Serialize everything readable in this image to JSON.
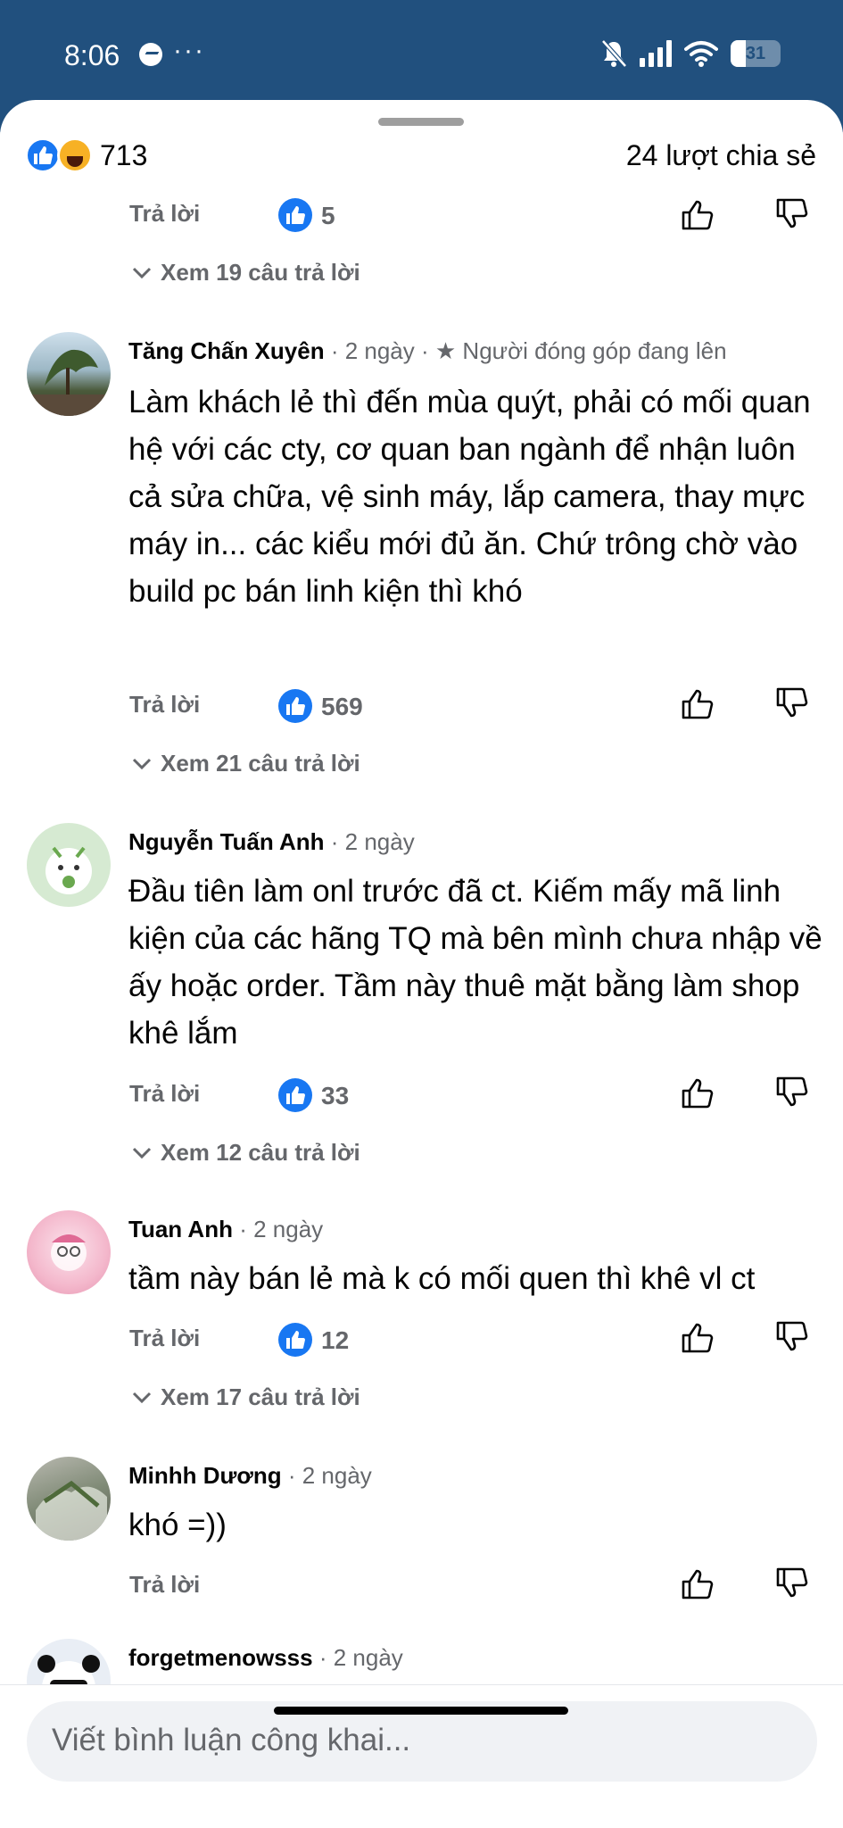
{
  "status_bar": {
    "time": "8:06",
    "more": "···",
    "battery_level": "31"
  },
  "header": {
    "reaction_count": "713",
    "shares": "24 lượt chia sẻ"
  },
  "colors": {
    "brand_blue": "#1877f2",
    "status_bar": "#21507e",
    "secondary_text": "#65676b"
  },
  "icons": [
    "messenger-icon",
    "bell-off-icon",
    "signal-icon",
    "wifi-icon",
    "battery-icon",
    "like-reaction-icon",
    "haha-reaction-icon",
    "thumb-up-icon",
    "thumb-down-icon",
    "chevron-down-icon"
  ],
  "top_actions": {
    "reply": "Trả lời",
    "likes": "5",
    "view_replies": "Xem 19 câu trả lời"
  },
  "comments": [
    {
      "author": "Tăng Chấn Xuyên",
      "time": "· 2 ngày ·",
      "badge": "Người đóng góp đang lên",
      "text": "Làm khách lẻ thì đến mùa quýt, phải có mối quan hệ với các cty, cơ quan ban ngành để nhận luôn cả sửa chữa, vệ sinh máy, lắp camera, thay mực máy in... các kiểu mới đủ ăn. Chứ trông chờ vào build pc bán linh kiện thì khó",
      "reply": "Trả lời",
      "likes": "569",
      "view_replies": "Xem 21 câu trả lời"
    },
    {
      "author": "Nguyễn Tuấn Anh",
      "time": "· 2 ngày",
      "text": "Đầu tiên làm onl trước đã ct. Kiếm mấy mã linh kiện của các hãng TQ mà bên mình chưa nhập về ấy hoặc order. Tầm này thuê mặt bằng làm shop khê lắm",
      "reply": "Trả lời",
      "likes": "33",
      "view_replies": "Xem 12 câu trả lời"
    },
    {
      "author": "Tuan Anh",
      "time": "· 2 ngày",
      "text": "tầm này bán lẻ mà k có mối quen thì khê vl ct",
      "reply": "Trả lời",
      "likes": "12",
      "view_replies": "Xem 17 câu trả lời"
    },
    {
      "author": "Minhh Dương",
      "time": "· 2 ngày",
      "text": "khó =))",
      "reply": "Trả lời"
    },
    {
      "author": "forgetmenowsss",
      "time": "· 2 ngày"
    }
  ],
  "composer": {
    "placeholder": "Viết bình luận công khai..."
  }
}
